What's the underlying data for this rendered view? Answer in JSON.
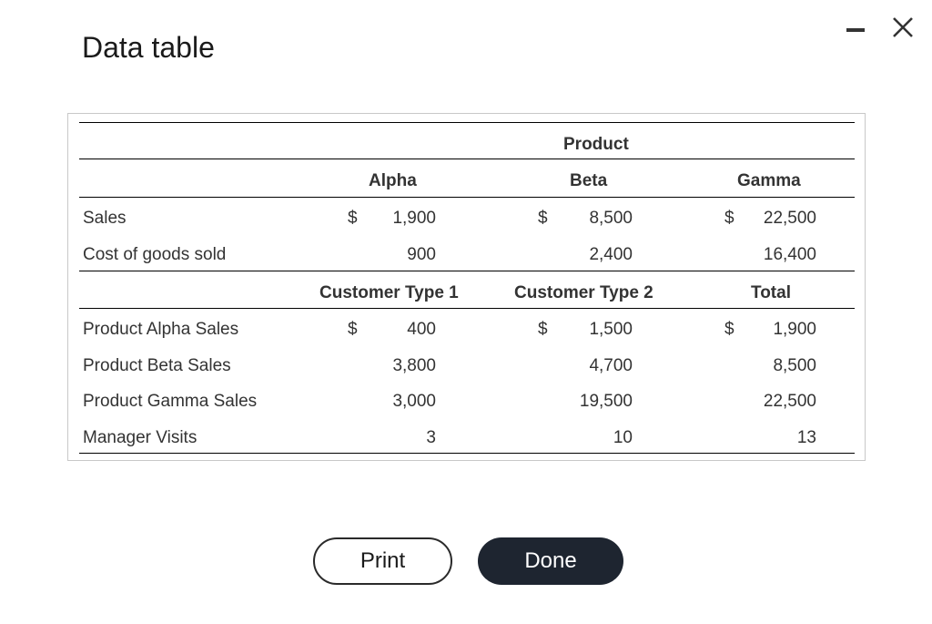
{
  "window": {
    "title": "Data table"
  },
  "table": {
    "group_header": "Product",
    "product_columns": [
      "Alpha",
      "Beta",
      "Gamma"
    ],
    "product_rows": [
      {
        "label": "Sales",
        "currency": [
          "$",
          "$",
          "$"
        ],
        "values": [
          "1,900",
          "8,500",
          "22,500"
        ]
      },
      {
        "label": "Cost of goods sold",
        "currency": [
          "",
          "",
          ""
        ],
        "values": [
          "900",
          "2,400",
          "16,400"
        ]
      }
    ],
    "customer_columns": [
      "Customer Type 1",
      "Customer Type 2",
      "Total"
    ],
    "customer_rows": [
      {
        "label": "Product Alpha Sales",
        "currency": [
          "$",
          "$",
          "$"
        ],
        "values": [
          "400",
          "1,500",
          "1,900"
        ]
      },
      {
        "label": "Product Beta Sales",
        "currency": [
          "",
          "",
          ""
        ],
        "values": [
          "3,800",
          "4,700",
          "8,500"
        ]
      },
      {
        "label": "Product Gamma Sales",
        "currency": [
          "",
          "",
          ""
        ],
        "values": [
          "3,000",
          "19,500",
          "22,500"
        ]
      },
      {
        "label": "Manager Visits",
        "currency": [
          "",
          "",
          ""
        ],
        "values": [
          "3",
          "10",
          "13"
        ]
      }
    ]
  },
  "buttons": {
    "print": "Print",
    "done": "Done"
  }
}
